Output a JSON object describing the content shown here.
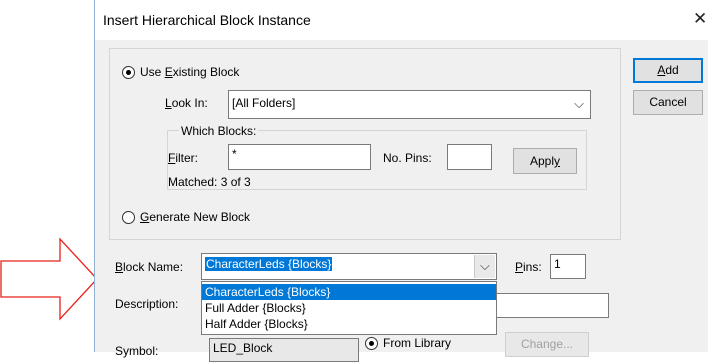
{
  "dialog": {
    "title": "Insert Hierarchical Block Instance",
    "close_glyph": "✕"
  },
  "buttons": {
    "add_pre": "",
    "add_u": "A",
    "add_post": "dd",
    "cancel": "Cancel",
    "apply_pre": "Appl",
    "apply_u": "y",
    "apply_post": "",
    "change": "Change..."
  },
  "existing": {
    "radio_pre": "Use ",
    "radio_u": "E",
    "radio_post": "xisting Block",
    "look_in_u": "L",
    "look_in_post": "ook In:",
    "look_in_value": "[All Folders]",
    "which_blocks": "Which Blocks:",
    "filter_u": "F",
    "filter_post": "ilter:",
    "filter_value": "*",
    "no_pins_label": "No. Pins:",
    "no_pins_value": "",
    "matched": "Matched: 3 of 3"
  },
  "generate": {
    "radio_u": "G",
    "radio_post": "enerate New Block"
  },
  "block": {
    "name_u": "B",
    "name_post": "lock Name:",
    "name_value": "CharacterLeds {Blocks}",
    "pins_u": "P",
    "pins_post": "ins:",
    "pins_value": "1",
    "description_label": "Description:",
    "symbol_label": "Symbol:",
    "symbol_value": "LED_Block",
    "from_library": "From Library",
    "options": [
      "CharacterLeds {Blocks}",
      "Full Adder {Blocks}",
      "Half Adder {Blocks}"
    ],
    "selected_index": 0
  },
  "annotation": {
    "arrow_color": "#e8211b"
  },
  "icons": {
    "dropdown": "chevron-down-icon",
    "close": "close-icon",
    "arrow": "right-arrow-icon"
  }
}
